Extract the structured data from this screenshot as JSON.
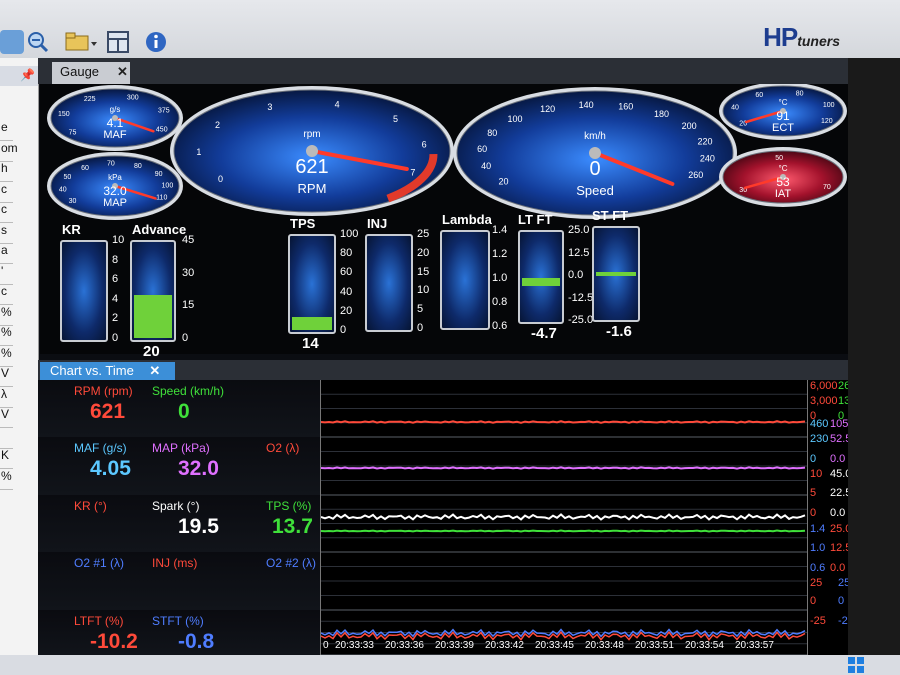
{
  "brand": {
    "main": "HP",
    "sub": "tuners"
  },
  "left_strip": {
    "items": [
      "e",
      "om",
      "h",
      "c",
      "c",
      "s",
      "a",
      "'",
      "c",
      "%",
      "%",
      "%",
      "V",
      "λ",
      "V",
      "",
      "K",
      "%"
    ]
  },
  "gauge_tab": {
    "label": "Gauge",
    "close": "✕"
  },
  "dials": {
    "maf": {
      "unit": "g/s",
      "value": "4.1",
      "name": "MAF",
      "ticks": [
        "75",
        "150",
        "225",
        "300",
        "375",
        "450"
      ]
    },
    "map": {
      "unit": "kPa",
      "value": "32.0",
      "name": "MAP",
      "ticks": [
        "30",
        "40",
        "50",
        "60",
        "70",
        "80",
        "90",
        "100",
        "110"
      ]
    },
    "rpm": {
      "unit": "rpm",
      "value": "621",
      "name": "RPM",
      "ticks": [
        "0",
        "1",
        "2",
        "3",
        "4",
        "5",
        "6",
        "7"
      ]
    },
    "speed": {
      "unit": "km/h",
      "value": "0",
      "name": "Speed",
      "ticks": [
        "20",
        "40",
        "60",
        "80",
        "100",
        "120",
        "140",
        "160",
        "180",
        "200",
        "220",
        "240",
        "260"
      ]
    },
    "ect": {
      "unit": "°C",
      "value": "91",
      "name": "ECT",
      "ticks": [
        "20",
        "40",
        "60",
        "80",
        "100",
        "120"
      ]
    },
    "iat": {
      "unit": "°C",
      "value": "53",
      "name": "IAT",
      "ticks": [
        "30",
        "50",
        "70"
      ]
    }
  },
  "bars": {
    "kr": {
      "label": "KR",
      "ticks": [
        "10",
        "8",
        "6",
        "4",
        "2",
        "0"
      ]
    },
    "advance": {
      "label": "Advance",
      "ticks": [
        "45",
        "30",
        "15",
        "0"
      ],
      "value": "20",
      "level": 0.44
    },
    "tps": {
      "label": "TPS",
      "ticks": [
        "100",
        "80",
        "60",
        "40",
        "20",
        "0"
      ],
      "value": "14",
      "level": 0.14
    },
    "inj": {
      "label": "INJ",
      "ticks": [
        "25",
        "20",
        "15",
        "10",
        "5",
        "0"
      ]
    },
    "lambda": {
      "label": "Lambda",
      "ticks": [
        "1.4",
        "1.2",
        "1.0",
        "0.8",
        "0.6"
      ]
    },
    "ltft": {
      "label": "LT FT",
      "ticks": [
        "25.0",
        "12.5",
        "0.0",
        "-12.5",
        "-25.0"
      ],
      "value": "-4.7"
    },
    "stft": {
      "label": "ST FT",
      "ticks": [],
      "value": "-1.6"
    }
  },
  "chart_tab": {
    "label": "Chart vs. Time",
    "close": "✕"
  },
  "lanes": [
    {
      "labels": [
        {
          "t": "RPM (rpm)",
          "c": "#ff4a3a"
        },
        {
          "t": "Speed (km/h)",
          "c": "#3fe03a"
        }
      ],
      "values": [
        {
          "t": "621",
          "c": "#ff4a3a"
        },
        {
          "t": "0",
          "c": "#3fe03a"
        }
      ]
    },
    {
      "labels": [
        {
          "t": "MAF (g/s)",
          "c": "#5cc8ff"
        },
        {
          "t": "MAP (kPa)",
          "c": "#e070ff"
        },
        {
          "t": "O2 (λ)",
          "c": "#ff4a3a"
        }
      ],
      "values": [
        {
          "t": "4.05",
          "c": "#5cc8ff"
        },
        {
          "t": "32.0",
          "c": "#e070ff"
        }
      ]
    },
    {
      "labels": [
        {
          "t": "KR (°)",
          "c": "#ff4a3a"
        },
        {
          "t": "Spark (°)",
          "c": "#ffffff"
        },
        {
          "t": "TPS (%)",
          "c": "#3fe03a"
        }
      ],
      "values": [
        {
          "t": "19.5",
          "c": "#ffffff"
        },
        {
          "t": "13.7",
          "c": "#3fe03a"
        }
      ]
    },
    {
      "labels": [
        {
          "t": "O2 #1 (λ)",
          "c": "#4f7dff"
        },
        {
          "t": "INJ (ms)",
          "c": "#ff4a3a"
        },
        {
          "t": "O2 #2 (λ)",
          "c": "#4f7dff"
        }
      ],
      "values": []
    },
    {
      "labels": [
        {
          "t": "LTFT (%)",
          "c": "#ff4a3a"
        },
        {
          "t": "STFT (%)",
          "c": "#4f7dff"
        }
      ],
      "values": [
        {
          "t": "-10.2",
          "c": "#ff4a3a"
        },
        {
          "t": "-0.8",
          "c": "#4f7dff"
        }
      ]
    }
  ],
  "time_axis": [
    "0",
    "20:33:33",
    "20:33:36",
    "20:33:39",
    "20:33:42",
    "20:33:45",
    "20:33:48",
    "20:33:51",
    "20:33:54",
    "20:33:57"
  ],
  "scales": [
    {
      "cols": [
        {
          "t": "6,000",
          "c": "#ff4a3a"
        },
        {
          "t": "260",
          "c": "#3fe03a"
        }
      ]
    },
    {
      "cols": [
        {
          "t": "3,000",
          "c": "#ff4a3a"
        },
        {
          "t": "130",
          "c": "#3fe03a"
        }
      ]
    },
    {
      "cols": [
        {
          "t": "0",
          "c": "#ff4a3a"
        },
        {
          "t": "0",
          "c": "#3fe03a"
        }
      ]
    },
    {
      "cols": [
        {
          "t": "460",
          "c": "#5cc8ff"
        },
        {
          "t": "105.0",
          "c": "#e070ff"
        },
        {
          "t": "1.4",
          "c": "#ff4a3a"
        }
      ]
    },
    {
      "cols": [
        {
          "t": "230",
          "c": "#5cc8ff"
        },
        {
          "t": "52.5",
          "c": "#e070ff"
        },
        {
          "t": "1.0",
          "c": "#ff4a3a"
        }
      ]
    },
    {
      "cols": [
        {
          "t": "0",
          "c": "#5cc8ff"
        },
        {
          "t": "0.0",
          "c": "#e070ff"
        },
        {
          "t": "0.6",
          "c": "#ff4a3a"
        }
      ]
    },
    {
      "cols": [
        {
          "t": "10",
          "c": "#ff4a3a"
        },
        {
          "t": "45.0",
          "c": "#ffffff"
        },
        {
          "t": "100",
          "c": "#3fe03a"
        }
      ]
    },
    {
      "cols": [
        {
          "t": "5",
          "c": "#ff4a3a"
        },
        {
          "t": "22.5",
          "c": "#ffffff"
        },
        {
          "t": "50",
          "c": "#3fe03a"
        }
      ]
    },
    {
      "cols": [
        {
          "t": "0",
          "c": "#ff4a3a"
        },
        {
          "t": "0.0",
          "c": "#ffffff"
        },
        {
          "t": "0",
          "c": "#3fe03a"
        }
      ]
    },
    {
      "cols": [
        {
          "t": "1.4",
          "c": "#4f7dff"
        },
        {
          "t": "25.0",
          "c": "#ff4a3a"
        },
        {
          "t": "1.4",
          "c": "#4f7dff"
        }
      ]
    },
    {
      "cols": [
        {
          "t": "1.0",
          "c": "#4f7dff"
        },
        {
          "t": "12.5",
          "c": "#ff4a3a"
        },
        {
          "t": "1.0",
          "c": "#4f7dff"
        }
      ]
    },
    {
      "cols": [
        {
          "t": "0.6",
          "c": "#4f7dff"
        },
        {
          "t": "0.0",
          "c": "#ff4a3a"
        },
        {
          "t": "0.6",
          "c": "#4f7dff"
        }
      ]
    },
    {
      "cols": [
        {
          "t": "25",
          "c": "#ff4a3a"
        },
        {
          "t": "25",
          "c": "#4f7dff"
        }
      ]
    },
    {
      "cols": [
        {
          "t": "0",
          "c": "#ff4a3a"
        },
        {
          "t": "0",
          "c": "#4f7dff"
        }
      ]
    },
    {
      "cols": [
        {
          "t": "-25",
          "c": "#ff4a3a"
        },
        {
          "t": "-25",
          "c": "#4f7dff"
        }
      ]
    }
  ],
  "colors": {
    "rpm": "#ff4a3a",
    "speed": "#3fe03a",
    "map": "#e070ff",
    "maf": "#5cc8ff",
    "o2": "#4f7dff"
  }
}
